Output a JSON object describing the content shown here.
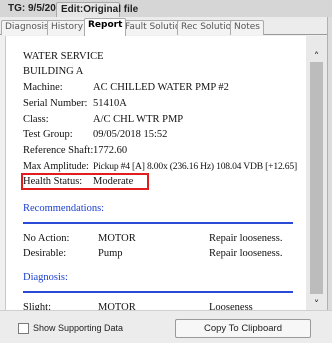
{
  "header": {
    "tg_label": "TG: 9/5/2018",
    "edit_label": "Edit:Original file"
  },
  "tabs": [
    {
      "label": "Diagnosis"
    },
    {
      "label": "History"
    },
    {
      "label": "Report"
    },
    {
      "label": "Fault Solution"
    },
    {
      "label": "Rec Solution"
    },
    {
      "label": "Notes"
    }
  ],
  "report": {
    "title1": "WATER SERVICE",
    "title2": "BUILDING A",
    "fields": [
      {
        "label": "Machine:",
        "value": "AC CHILLED WATER PMP #2"
      },
      {
        "label": "Serial Number:",
        "value": "51410A"
      },
      {
        "label": "Class:",
        "value": "A/C CHL WTR PMP"
      },
      {
        "label": "Test Group:",
        "value": "09/05/2018 15:52"
      },
      {
        "label": "Reference Shaft:",
        "value": "1772.60"
      },
      {
        "label": "Max Amplitude:",
        "value": "Pickup #4 [A] 8.00x (236.16 Hz) 108.04 VDB [+12.65]"
      }
    ],
    "health_status": {
      "label": "Health Status:",
      "value": "Moderate"
    },
    "recommendations_heading": "Recommendations:",
    "recommendations": [
      {
        "priority": "No Action:",
        "component": "MOTOR",
        "action": "Repair looseness."
      },
      {
        "priority": "Desirable:",
        "component": "Pump",
        "action": "Repair looseness."
      }
    ],
    "diagnosis_heading": "Diagnosis:",
    "diagnosis": [
      {
        "severity": "Slight:",
        "component": "MOTOR",
        "fault": "Looseness"
      }
    ]
  },
  "footer": {
    "show_supporting_label": "Show Supporting Data",
    "copy_button_label": "Copy To Clipboard"
  },
  "colors": {
    "section_heading": "#1a3fd0",
    "highlight_box": "#e21d1d"
  },
  "icons": {
    "scroll_up": "chevron-up-icon",
    "scroll_down": "chevron-down-icon"
  }
}
